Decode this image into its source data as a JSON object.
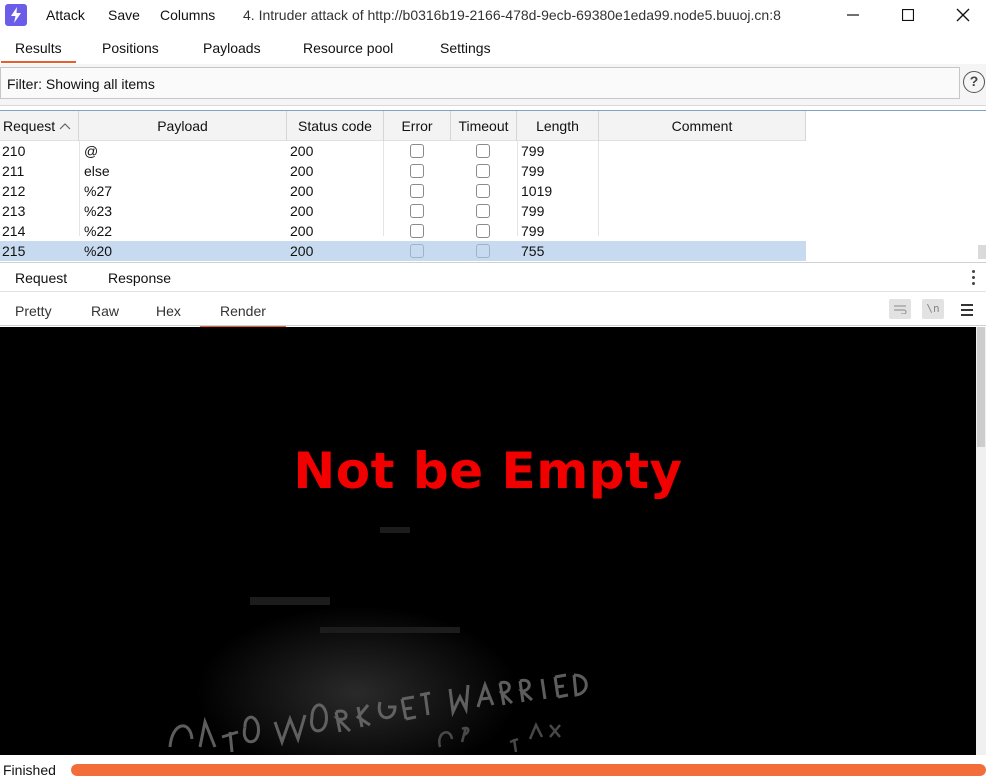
{
  "window": {
    "title": "4. Intruder attack of http://b0316b19-2166-478d-9ecb-69380e1eda99.node5.buuoj.cn:8",
    "menu": [
      "Attack",
      "Save",
      "Columns"
    ]
  },
  "tabs": [
    "Results",
    "Positions",
    "Payloads",
    "Resource pool",
    "Settings"
  ],
  "active_tab": "Results",
  "filter": {
    "label": "Filter: Showing all items",
    "help": "?"
  },
  "table": {
    "columns": [
      "Request",
      "Payload",
      "Status code",
      "Error",
      "Timeout",
      "Length",
      "Comment"
    ],
    "sort_indicator": "^",
    "rows": [
      {
        "request": "210",
        "payload": "@",
        "status": "200",
        "error": false,
        "timeout": false,
        "length": "799",
        "comment": ""
      },
      {
        "request": "211",
        "payload": "else",
        "status": "200",
        "error": false,
        "timeout": false,
        "length": "799",
        "comment": ""
      },
      {
        "request": "212",
        "payload": "%27",
        "status": "200",
        "error": false,
        "timeout": false,
        "length": "1019",
        "comment": ""
      },
      {
        "request": "213",
        "payload": "%23",
        "status": "200",
        "error": false,
        "timeout": false,
        "length": "799",
        "comment": ""
      },
      {
        "request": "214",
        "payload": "%22",
        "status": "200",
        "error": false,
        "timeout": false,
        "length": "799",
        "comment": ""
      },
      {
        "request": "215",
        "payload": "%20",
        "status": "200",
        "error": false,
        "timeout": false,
        "length": "755",
        "comment": "",
        "selected": true
      }
    ]
  },
  "message_tabs": [
    "Request",
    "Response"
  ],
  "active_message_tab": "Response",
  "view_tabs": [
    "Pretty",
    "Raw",
    "Hex",
    "Render"
  ],
  "active_view_tab": "Render",
  "view_tools": {
    "wrap_icon": "word-wrap-icon",
    "newline": "\\n",
    "menu_icon": "hamburger-menu-icon"
  },
  "render": {
    "headline": "Not be Empty",
    "headline_color": "#f20000",
    "background": "#000000"
  },
  "status": {
    "text": "Finished",
    "progress": 1.0,
    "progress_color": "#f26d3a"
  },
  "colors": {
    "accent": "#e6602f",
    "selection": "#c7daf0",
    "app_icon": "#6b5de8"
  }
}
